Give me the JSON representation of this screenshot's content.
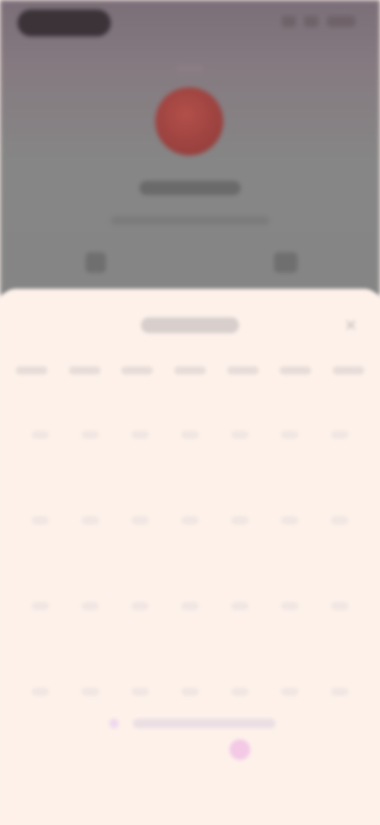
{
  "status_bar": {
    "icons": [
      "signal-icon",
      "wifi-icon",
      "battery-icon"
    ]
  },
  "hero": {
    "avatar_color": "#9e4340",
    "icons": [
      "left-action-icon",
      "right-action-icon"
    ]
  },
  "sheet": {
    "close_icon": "close-icon",
    "weekdays_count": 7
  },
  "colors": {
    "overlay": "#868686",
    "sheet_background": "#fdf1ea",
    "accent_marker": "#f3c9e6"
  }
}
